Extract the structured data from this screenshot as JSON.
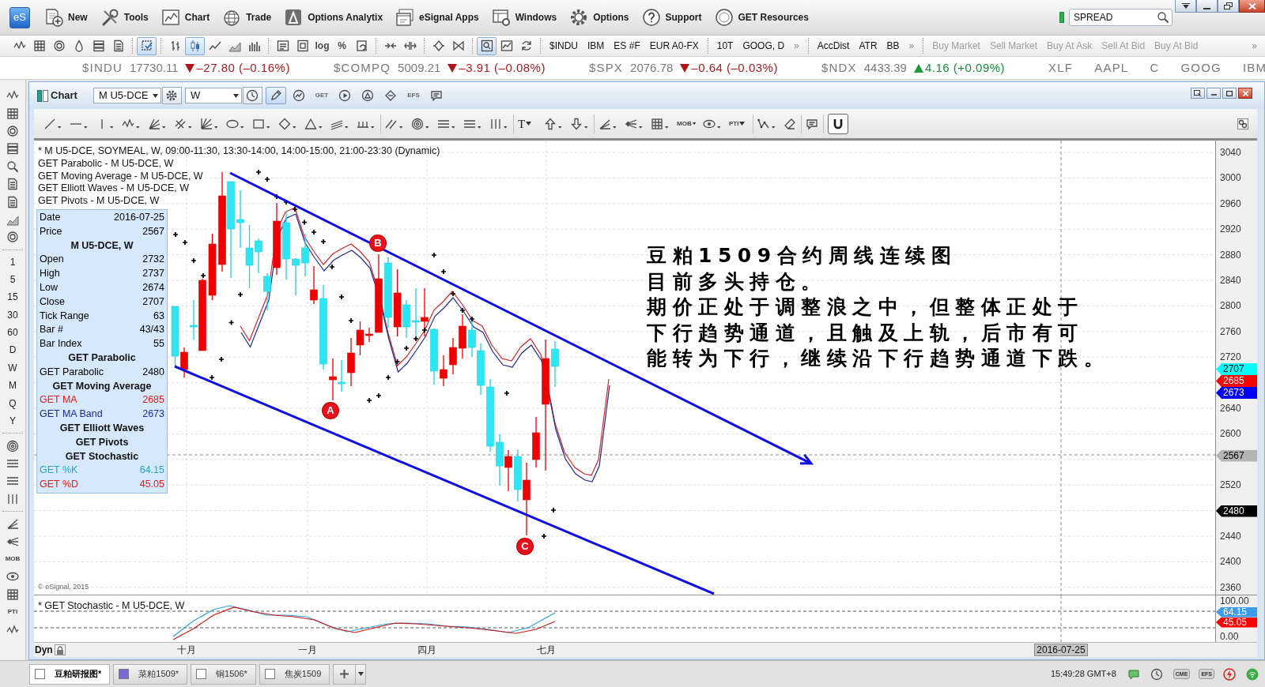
{
  "menu_bar": {
    "logo": "eS",
    "items": [
      {
        "label": "New"
      },
      {
        "label": "Tools"
      },
      {
        "label": "Chart"
      },
      {
        "label": "Trade"
      },
      {
        "label": "Options Analytix"
      },
      {
        "label": "eSignal Apps"
      },
      {
        "label": "Windows"
      },
      {
        "label": "Options"
      },
      {
        "label": "Support"
      },
      {
        "label": "GET Resources"
      }
    ],
    "search": {
      "value": "SPREAD"
    }
  },
  "toolbar": {
    "tools": [
      {
        "pressed": false
      },
      {
        "pressed": false
      },
      {
        "pressed": false
      },
      {
        "pressed": false
      },
      {
        "pressed": false
      },
      {
        "pressed": false
      },
      {
        "pressed": true
      },
      {
        "pressed": false
      },
      {
        "pressed": true
      },
      {
        "pressed": false
      },
      {
        "pressed": false
      },
      {
        "pressed": false
      },
      {
        "pressed": false
      },
      {
        "pressed": false
      },
      {
        "label": "log",
        "pressed": false
      },
      {
        "label": "%",
        "pressed": false
      },
      {
        "pressed": false
      },
      {
        "pressed": false
      },
      {
        "pressed": false
      },
      {
        "pressed": false
      },
      {
        "pressed": false
      },
      {
        "pressed": true
      },
      {
        "pressed": false
      },
      {
        "pressed": false
      }
    ],
    "symbols": [
      "$INDU",
      "IBM",
      "ES #F",
      "EUR A0-FX"
    ],
    "pages": [
      "10T",
      "GOOG, D"
    ],
    "studies": [
      "AccDist",
      "ATR",
      "BB"
    ],
    "orders": [
      {
        "label": "Buy Market",
        "disabled": true
      },
      {
        "label": "Sell Market",
        "disabled": true
      },
      {
        "label": "Buy At Ask",
        "disabled": true
      },
      {
        "label": "Sell At Bid",
        "disabled": true
      },
      {
        "label": "Buy At Bid",
        "disabled": true
      }
    ],
    "overflow": [
      "»",
      "»",
      "»"
    ]
  },
  "tickers": [
    {
      "symbol": "$INDU",
      "price": "17730.11",
      "change": "–27.80 (–0.16%)",
      "rising": false
    },
    {
      "symbol": "$COMPQ",
      "price": "5009.21",
      "change": "–3.91 (–0.08%)",
      "rising": false
    },
    {
      "symbol": "$SPX",
      "price": "2076.78",
      "change": "–0.64 (–0.03%)",
      "rising": false
    },
    {
      "symbol": "$NDX",
      "price": "4433.39",
      "change": "4.16 (+0.09%)",
      "rising": true
    },
    {
      "symbol": "XLF"
    },
    {
      "symbol": "AAPL"
    },
    {
      "symbol": "C"
    },
    {
      "symbol": "GOOG"
    },
    {
      "symbol": "IBM"
    }
  ],
  "side_toolbar": {
    "intervals": [
      "1",
      "5",
      "15",
      "30",
      "60",
      "D",
      "W",
      "M",
      "Q",
      "Y"
    ],
    "mob_label": "MOB",
    "pti_label": "PTI"
  },
  "chart_window": {
    "title": "Chart",
    "symbol": "M U5-DCE",
    "interval": "W",
    "tools": [
      {
        "pressed": true
      },
      {
        "pressed": false
      },
      {
        "label": "GET",
        "pressed": false
      },
      {
        "pressed": false
      },
      {
        "pressed": false
      },
      {
        "pressed": false
      },
      {
        "label": "EFS",
        "pressed": false
      },
      {
        "pressed": false
      }
    ],
    "drawing_tools": [
      {
        "pressed": false
      },
      {
        "pressed": false
      },
      {
        "pressed": false
      },
      {
        "pressed": false
      },
      {
        "pressed": false
      },
      {
        "pressed": false
      },
      {
        "pressed": false
      },
      {
        "pressed": false
      },
      {
        "pressed": false
      },
      {
        "pressed": false
      },
      {
        "pressed": false
      },
      {
        "pressed": false
      },
      {
        "pressed": false
      },
      {
        "pressed": false
      },
      {
        "pressed": false
      },
      {
        "pressed": false
      },
      {
        "pressed": false
      },
      {
        "pressed": false
      },
      {
        "label": "T",
        "pressed": false
      },
      {
        "pressed": false
      },
      {
        "pressed": false
      },
      {
        "pressed": false
      },
      {
        "pressed": false
      },
      {
        "pressed": false
      },
      {
        "label": "MOB",
        "pressed": false
      },
      {
        "pressed": false
      },
      {
        "label": "PTI",
        "pressed": false
      },
      {
        "pressed": false
      },
      {
        "pressed": false
      },
      {
        "pressed": false
      },
      {
        "pressed": true
      }
    ]
  },
  "legend": [
    "* M U5-DCE, SOYMEAL, W, 09:00-11:30, 13:30-14:00, 14:00-15:00, 21:00-23:30 (Dynamic)",
    "GET Parabolic - M U5-DCE, W",
    "GET Moving Average - M U5-DCE, W",
    "GET Elliott Waves - M U5-DCE, W",
    "GET Pivots - M U5-DCE, W"
  ],
  "data_window": [
    {
      "kind": "value",
      "label": "Date",
      "value": "2016-07-25",
      "color": "#000000"
    },
    {
      "kind": "value",
      "label": "Price",
      "value": "2567",
      "color": "#000000"
    },
    {
      "kind": "header",
      "label": "M U5-DCE, W"
    },
    {
      "kind": "value",
      "label": "Open",
      "value": "2732",
      "color": "#000000"
    },
    {
      "kind": "value",
      "label": "High",
      "value": "2737",
      "color": "#000000"
    },
    {
      "kind": "value",
      "label": "Low",
      "value": "2674",
      "color": "#000000"
    },
    {
      "kind": "value",
      "label": "Close",
      "value": "2707",
      "color": "#000000"
    },
    {
      "kind": "value",
      "label": "Tick Range",
      "value": "63",
      "color": "#000000"
    },
    {
      "kind": "value",
      "label": "Bar #",
      "value": "43/43",
      "color": "#000000"
    },
    {
      "kind": "value",
      "label": "Bar Index",
      "value": "55",
      "color": "#000000"
    },
    {
      "kind": "header",
      "label": "GET Parabolic"
    },
    {
      "kind": "value",
      "label": "GET Parabolic",
      "value": "2480",
      "color": "#000000"
    },
    {
      "kind": "header",
      "label": "GET Moving Average"
    },
    {
      "kind": "value",
      "label": "GET MA",
      "value": "2685",
      "color": "#e0201c"
    },
    {
      "kind": "value",
      "label": "GET MA Band",
      "value": "2673",
      "color": "#1c2a9c"
    },
    {
      "kind": "header",
      "label": "GET Elliott Waves"
    },
    {
      "kind": "header",
      "label": "GET Pivots"
    },
    {
      "kind": "header",
      "label": "GET Stochastic"
    },
    {
      "kind": "value",
      "label": "GET %K",
      "value": "64.15",
      "color": "#2aa7c0"
    },
    {
      "kind": "value",
      "label": "GET %D",
      "value": "45.05",
      "color": "#e0201c"
    }
  ],
  "price_axis": {
    "ticks": [
      "3040",
      "3000",
      "2960",
      "2920",
      "2880",
      "2840",
      "2800",
      "2760",
      "2720",
      "2640",
      "2600",
      "2520",
      "2440",
      "2400",
      "2360"
    ],
    "tags": [
      {
        "text": "2707",
        "color": "#00ffff"
      },
      {
        "text": "2685",
        "color": "#ff0000"
      },
      {
        "text": "2673",
        "color": "#0000ff"
      },
      {
        "text": "2567",
        "color": "#b4b4b4"
      },
      {
        "text": "2480",
        "color": "#000000"
      }
    ]
  },
  "wave_labels": [
    "A",
    "B",
    "C"
  ],
  "annotation": {
    "title": "豆粕1509合约周线连续图",
    "lines": [
      "目前多头持仓。",
      "期价正处于调整浪之中，但整体正处于",
      "下行趋势通道，且触及上轨，后市有可",
      "能转为下行，继续沿下行趋势通道下跌。"
    ]
  },
  "copyright": "© eSignal, 2015",
  "stochastic": {
    "title": "* GET Stochastic - M U5-DCE, W",
    "ticks": [
      "100.00",
      "0.00"
    ],
    "tags": [
      {
        "text": "64.15",
        "color": "#3d9be9"
      },
      {
        "text": "45.05",
        "color": "#ff0000"
      }
    ]
  },
  "time_axis": {
    "mode": "Dyn",
    "months": [
      "十月",
      "一月",
      "四月",
      "七月"
    ],
    "cursor_date": "2016-07-25"
  },
  "tabs": [
    {
      "label": "豆粕研报图*",
      "selected": true,
      "color": "#ffffff"
    },
    {
      "label": "菜粕1509*",
      "selected": false,
      "color": "#7b68d8"
    },
    {
      "label": "铜1506*",
      "selected": false,
      "color": "#ffffff"
    },
    {
      "label": "焦炭1509",
      "selected": false,
      "color": "#ffffff"
    }
  ],
  "status_bar": {
    "time": "15:49:28 GMT+8",
    "cme_label": "CME",
    "efs_label": "EFS"
  }
}
